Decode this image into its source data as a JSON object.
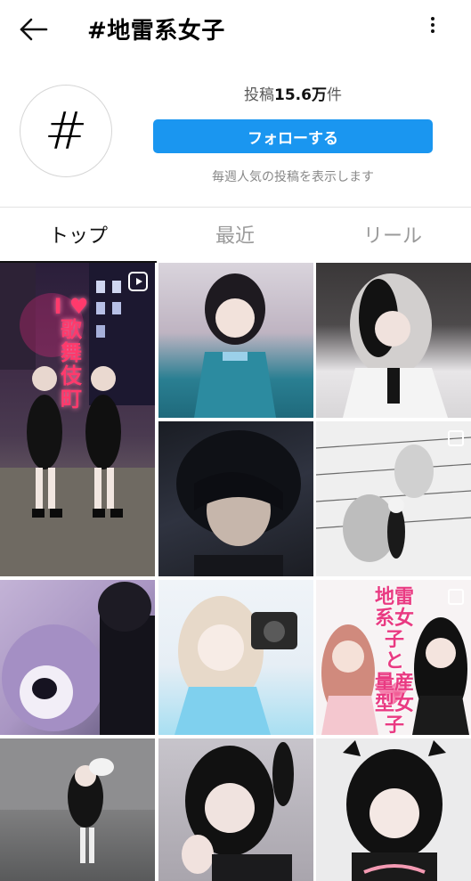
{
  "header": {
    "title": "#地雷系女子"
  },
  "profile": {
    "icon_glyph": "#",
    "post_count_prefix": "投稿",
    "post_count_value": "15.6万",
    "post_count_suffix": "件",
    "follow_label": "フォローする",
    "subtitle": "毎週人気の投稿を表示します"
  },
  "tabs": [
    {
      "label": "トップ",
      "active": true
    },
    {
      "label": "最近",
      "active": false
    },
    {
      "label": "リール",
      "active": false
    }
  ],
  "grid": {
    "tiles": [
      {
        "name": "post-kabukicho-night-reel",
        "overlay": "reel",
        "caption": "I ♥ 歌舞伎町"
      },
      {
        "name": "post-girl-blue-dress",
        "overlay": "none",
        "caption": ""
      },
      {
        "name": "post-girl-grey-hair",
        "overlay": "none",
        "caption": ""
      },
      {
        "name": "post-dark-hair-portrait",
        "overlay": "none",
        "caption": ""
      },
      {
        "name": "post-manga-illustration",
        "overlay": "multi",
        "caption": ""
      },
      {
        "name": "post-purple-bear",
        "overlay": "none",
        "caption": ""
      },
      {
        "name": "post-blonde-camera",
        "overlay": "none",
        "caption": ""
      },
      {
        "name": "post-illustration-jiraikei-ryousangata",
        "overlay": "multi",
        "caption": "地雷系女子 と 量産型女子"
      },
      {
        "name": "post-street-outfit",
        "overlay": "none",
        "caption": ""
      },
      {
        "name": "post-twintail-selfie",
        "overlay": "none",
        "caption": ""
      },
      {
        "name": "post-bob-cat-ears",
        "overlay": "none",
        "caption": ""
      }
    ]
  },
  "colors": {
    "accent": "#1a96f0",
    "text_muted": "#888888",
    "tab_inactive": "#9a9a9a"
  }
}
